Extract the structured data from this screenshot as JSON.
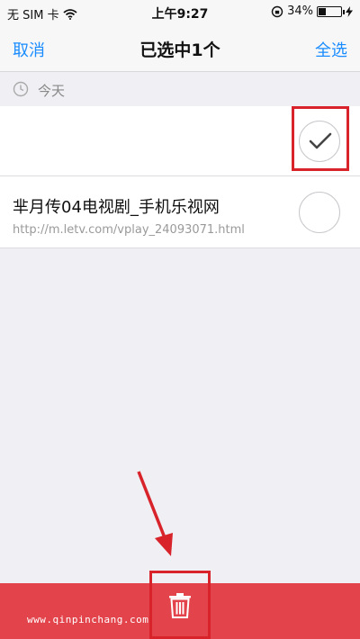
{
  "status_bar": {
    "carrier": "无 SIM 卡",
    "time": "上午9:27",
    "battery_percent": "34%",
    "battery_level": 0.34,
    "icons": [
      "wifi-icon",
      "orientation-lock-icon",
      "battery-icon",
      "charging-icon"
    ]
  },
  "nav": {
    "cancel_label": "取消",
    "title": "已选中1个",
    "select_all_label": "全选"
  },
  "section": {
    "label": "今天",
    "icon": "clock-icon"
  },
  "items": [
    {
      "title": "",
      "url": "",
      "selected": true
    },
    {
      "title": "芈月传04电视剧_手机乐视网",
      "url": "http://m.letv.com/vplay_24093071.html",
      "selected": false
    }
  ],
  "bottom_bar": {
    "action_icon": "trash-icon",
    "watermark": "www.qinpinchang.com"
  },
  "colors": {
    "accent": "#1a8cff",
    "delete_bar": "#e3444c",
    "annotation": "#d8232a"
  }
}
